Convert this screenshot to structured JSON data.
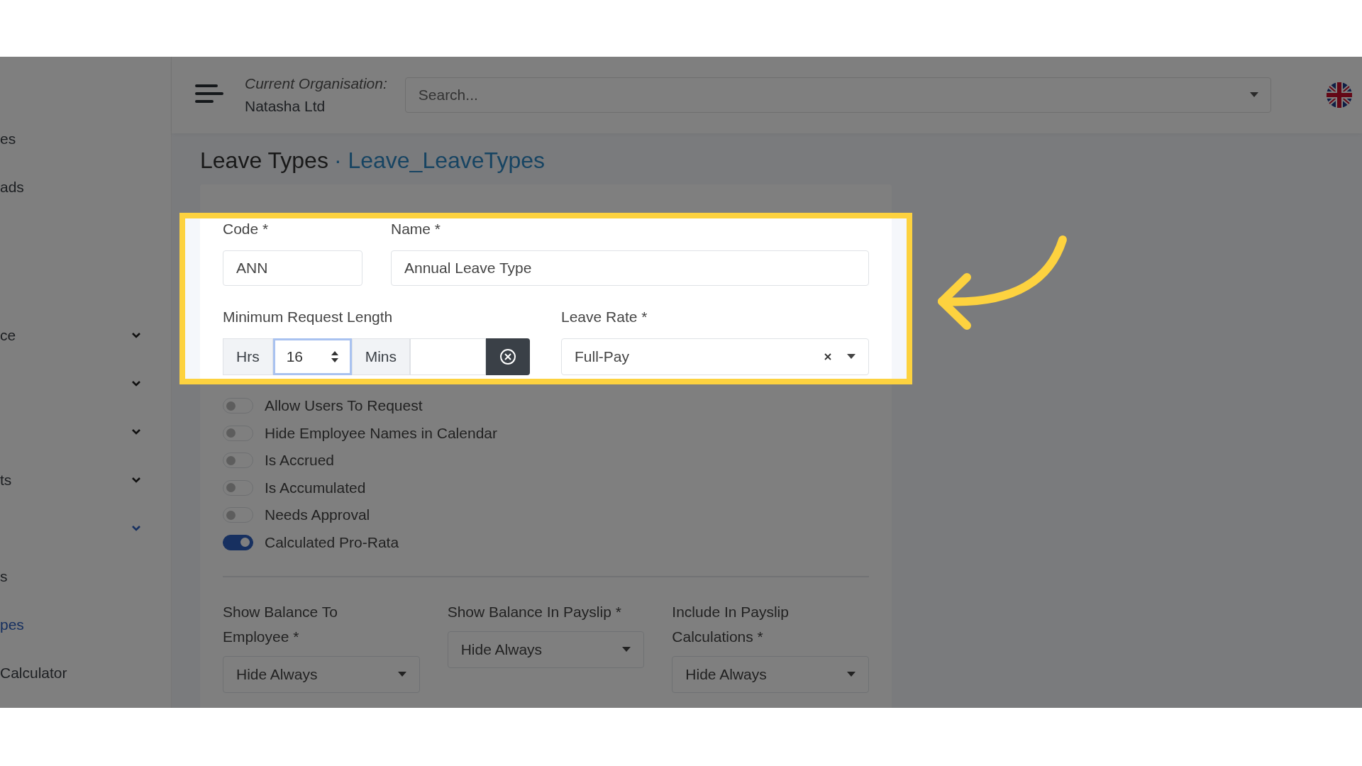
{
  "top_bar": {
    "org_label": "Current Organisation:",
    "org_name": "Natasha Ltd",
    "search": {
      "placeholder": "Search..."
    }
  },
  "sidebar": {
    "top_items": [
      {
        "label": "es"
      },
      {
        "label": "ads"
      }
    ],
    "menu_items": [
      {
        "kind": "group",
        "label": "ce",
        "expanded": false
      },
      {
        "kind": "group",
        "expanded": false
      },
      {
        "kind": "group",
        "expanded": false
      },
      {
        "kind": "group",
        "label": "ts",
        "expanded": false
      },
      {
        "kind": "group",
        "expanded": true
      },
      {
        "kind": "link",
        "label": "s",
        "selected": false
      },
      {
        "kind": "link",
        "label": "pes",
        "selected": true
      },
      {
        "kind": "link",
        "label": "Calculator",
        "selected": false
      }
    ]
  },
  "page": {
    "title": "Leave Types",
    "subtitle": "· Leave_LeaveTypes"
  },
  "form": {
    "code": {
      "label": "Code *",
      "value": "ANN"
    },
    "name": {
      "label": "Name *",
      "value": "Annual Leave Type"
    },
    "min_length": {
      "label": "Minimum Request Length",
      "hrs_label": "Hrs",
      "hrs_value": "16",
      "hrs_focused": true,
      "mins_label": "Mins"
    },
    "leave_rate": {
      "label": "Leave Rate *",
      "value": "Full-Pay"
    },
    "toggles": [
      {
        "label": "Allow Users To Request",
        "on": false
      },
      {
        "label": "Hide Employee Names in Calendar",
        "on": false
      },
      {
        "label": "Is Accrued",
        "on": false
      },
      {
        "label": "Is Accumulated",
        "on": false
      },
      {
        "label": "Needs Approval",
        "on": false
      },
      {
        "label": "Calculated Pro-Rata",
        "on": true
      }
    ],
    "selects": [
      {
        "label": "Show Balance To Employee *",
        "value": "Hide Always"
      },
      {
        "label": "Show Balance In Payslip *",
        "value": "Hide Always"
      },
      {
        "label": "Include In Payslip Calculations *",
        "value": "Hide Always"
      }
    ]
  }
}
